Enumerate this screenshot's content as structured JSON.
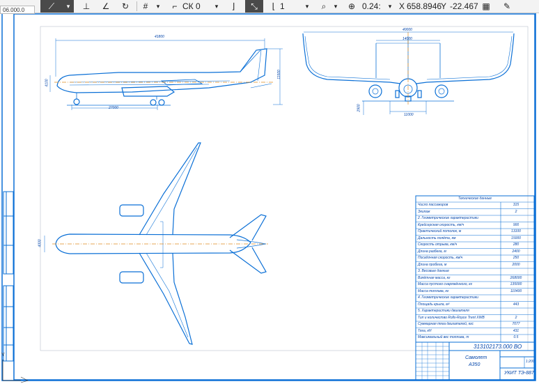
{
  "toolbar": {
    "layer_label": "СК 0",
    "line_value": "1",
    "zoom_value": "0.24:",
    "x_label": "X",
    "x_value": "658.8946",
    "y_label": "Y",
    "y_value": "-22.467",
    "accent_color": "#4a4a4a"
  },
  "doc_tab": {
    "label": "06.000.0"
  },
  "drawing": {
    "line_color": "#0a6fd6",
    "axis_color": "#e08a1e",
    "dims": {
      "side_length": "41800",
      "side_height": "11500",
      "side_fuselage_h": "4100",
      "side_gear_base": "27000",
      "front_span": "40000",
      "front_stab": "14000",
      "front_track": "11000",
      "front_ground": "2900",
      "top_width": "4000"
    }
  },
  "spec_table": {
    "title": "Технические данные",
    "rows": [
      {
        "name": "Число пассажиров",
        "value": "315"
      },
      {
        "name": "Экипаж",
        "value": "2"
      },
      {
        "name": "2. Геометрические характеристики",
        "value": ""
      },
      {
        "name": "Крейсерская скорость, км/ч",
        "value": "900"
      },
      {
        "name": "Практический потолок, м",
        "value": "13100"
      },
      {
        "name": "Дальность полёта, км",
        "value": "15000"
      },
      {
        "name": "Скорость отрыва, км/ч",
        "value": "280"
      },
      {
        "name": "Длина разбега, м",
        "value": "2400"
      },
      {
        "name": "Посадочная скорость, км/ч",
        "value": "250"
      },
      {
        "name": "Длина пробега, м",
        "value": "2000"
      },
      {
        "name": "3. Весовые данные",
        "value": ""
      },
      {
        "name": "Взлётная масса, кг",
        "value": "268000"
      },
      {
        "name": "Масса пустого снаряжённого, кг",
        "value": "135000"
      },
      {
        "name": "Масса топлива, кг",
        "value": "110400"
      },
      {
        "name": "4. Геометрические характеристики",
        "value": ""
      },
      {
        "name": "Площадь крыла, м²",
        "value": "443"
      },
      {
        "name": "5. Характеристики двигателя",
        "value": ""
      },
      {
        "name": "Тип и количество Rolls-Royce Trent XWB",
        "value": "2"
      },
      {
        "name": "Суммарная тяга двигателей, кгс",
        "value": "7077"
      },
      {
        "name": "Тяга, кН",
        "value": "431"
      },
      {
        "name": "Максимальный вес топлива, т",
        "value": "0.5"
      }
    ]
  },
  "title_block": {
    "doc_number": "313102173.000 ВО",
    "name_line1": "Самолет",
    "name_line2": "A350",
    "scale": "1:200",
    "org": "УКИТ ТЭ-887"
  }
}
